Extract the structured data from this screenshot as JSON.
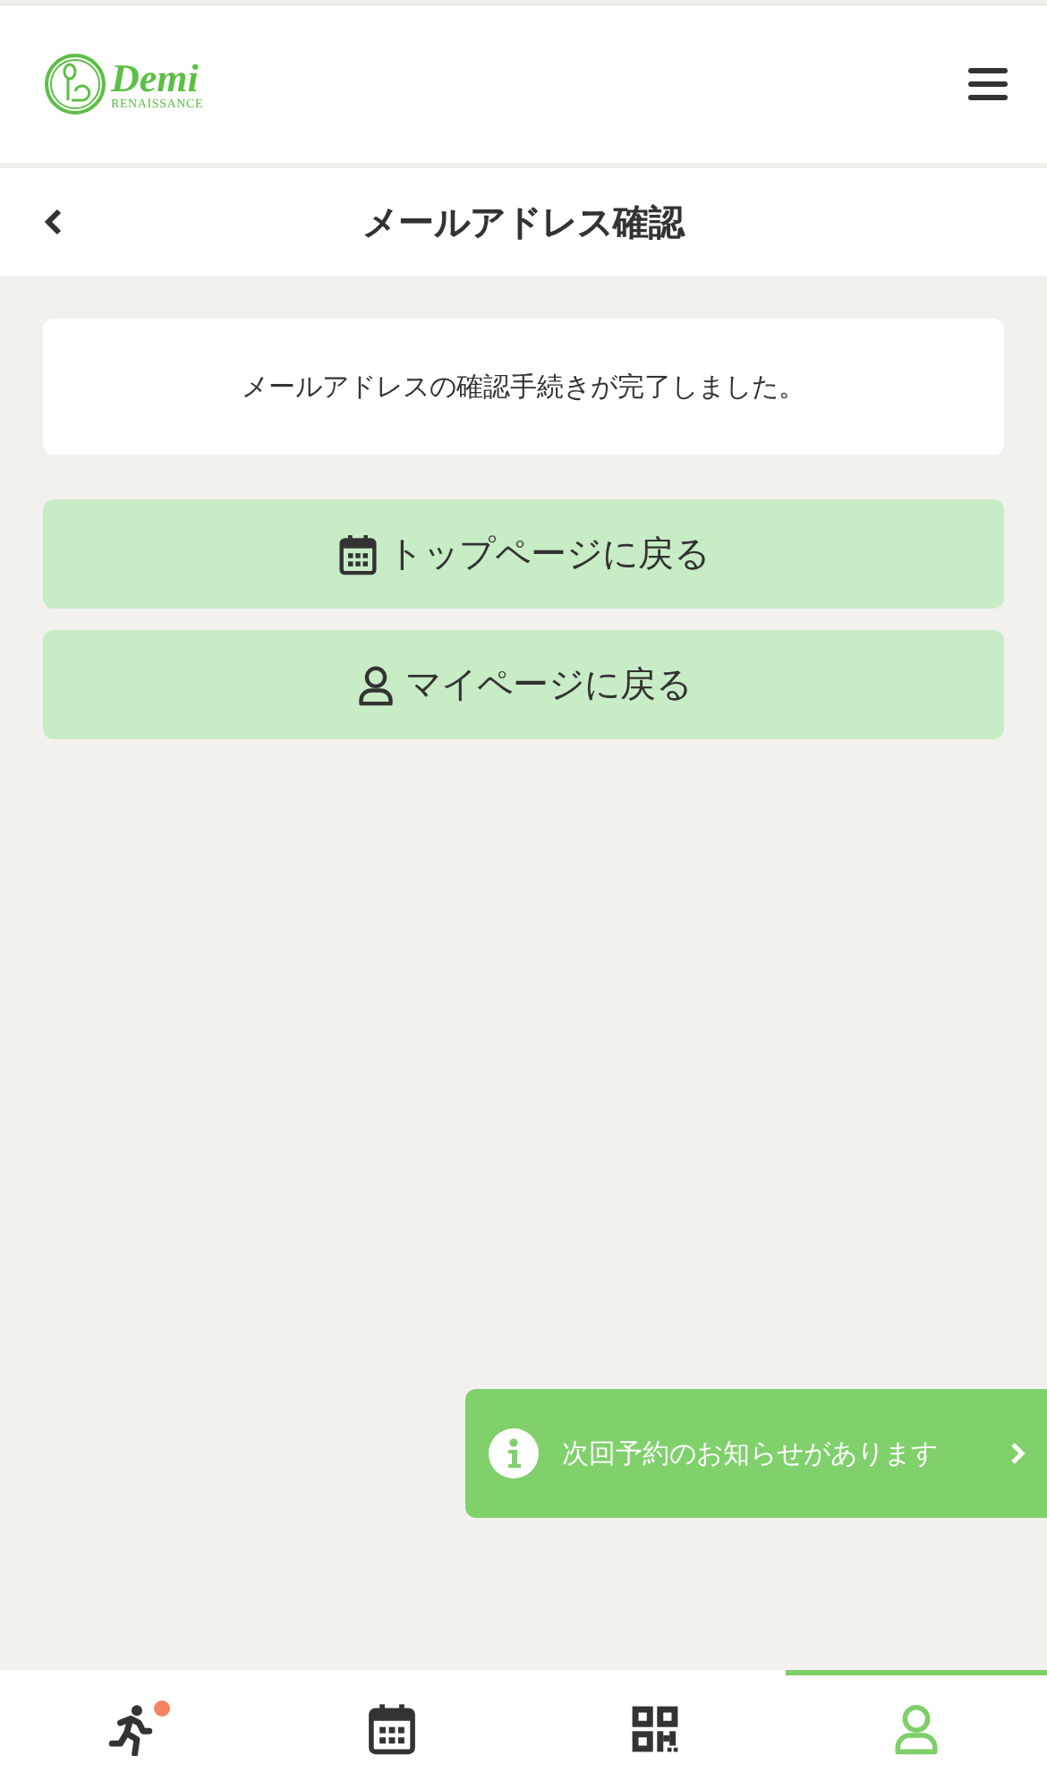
{
  "header": {
    "logo": {
      "name": "Demi",
      "subtitle": "RENAISSANCE"
    }
  },
  "title_bar": {
    "title": "メールアドレス確認"
  },
  "message": "メールアドレスの確認手続きが完了しました。",
  "buttons": [
    {
      "label": "トップページに戻る",
      "kind": "calendar"
    },
    {
      "label": "マイページに戻る",
      "kind": "user"
    }
  ],
  "notice": {
    "text": "次回予約のお知らせがあります"
  },
  "bottom_nav": [
    {
      "kind": "run",
      "selected": false,
      "badge": true
    },
    {
      "kind": "calendar",
      "selected": false,
      "badge": false
    },
    {
      "kind": "qr",
      "selected": false,
      "badge": false
    },
    {
      "kind": "user",
      "selected": true,
      "badge": false
    }
  ]
}
